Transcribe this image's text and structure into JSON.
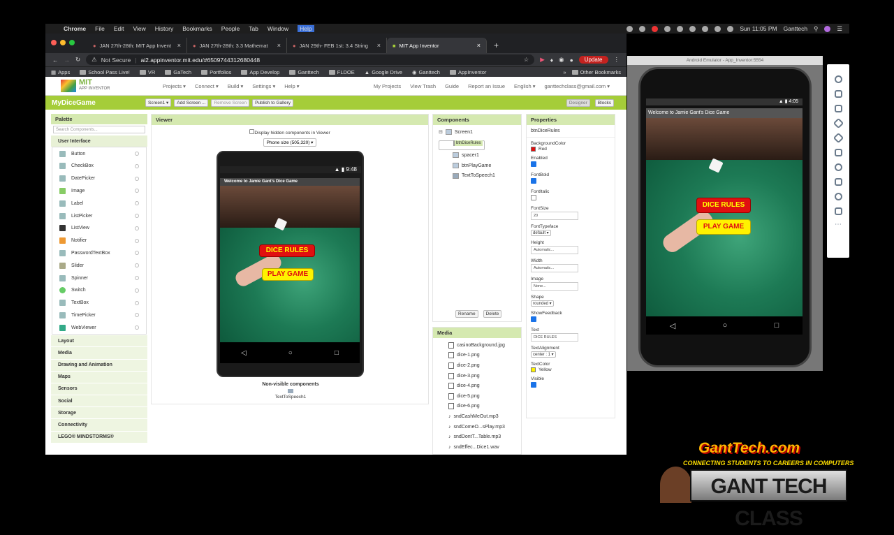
{
  "menubar": {
    "app": "Chrome",
    "items": [
      "File",
      "Edit",
      "View",
      "History",
      "Bookmarks",
      "People",
      "Tab",
      "Window",
      "Help"
    ],
    "clock": "Sun 11:05 PM",
    "user": "Ganttech"
  },
  "tabs": [
    {
      "label": "JAN 27th-28th: MIT App Invent"
    },
    {
      "label": "JAN 27th-28th: 3.3 Mathemat"
    },
    {
      "label": "JAN 29th- FEB 1st: 3.4 String"
    },
    {
      "label": "MIT App Inventor",
      "active": true
    }
  ],
  "address": {
    "security": "Not Secure",
    "url": "ai2.appinventor.mit.edu/#6509744312680448",
    "update": "Update"
  },
  "bookmarks": [
    "Apps",
    "School Pass Live!",
    "VR",
    "GaTech",
    "Portfolios",
    "App Develop",
    "Ganttech",
    "FLDOE",
    "Google Drive",
    "Ganttech",
    "AppInventor",
    "Other Bookmarks"
  ],
  "ai_header": {
    "logo_title": "MIT",
    "logo_sub": "APP INVENTOR",
    "nav": [
      "Projects ▾",
      "Connect ▾",
      "Build ▾",
      "Settings ▾",
      "Help ▾"
    ],
    "right": [
      "My Projects",
      "View Trash",
      "Guide",
      "Report an Issue",
      "English ▾",
      "ganttechclass@gmail.com ▾"
    ]
  },
  "project": {
    "name": "MyDiceGame",
    "screen": "Screen1 ▾",
    "add_screen": "Add Screen ...",
    "remove_screen": "Remove Screen",
    "publish": "Publish to Gallery",
    "designer": "Designer",
    "blocks": "Blocks"
  },
  "palette": {
    "title": "Palette",
    "search_placeholder": "Search Components...",
    "category": "User Interface",
    "items": [
      "Button",
      "CheckBox",
      "DatePicker",
      "Image",
      "Label",
      "ListPicker",
      "ListView",
      "Notifier",
      "PasswordTextBox",
      "Slider",
      "Spinner",
      "Switch",
      "TextBox",
      "TimePicker",
      "WebViewer"
    ],
    "categories": [
      "Layout",
      "Media",
      "Drawing and Animation",
      "Maps",
      "Sensors",
      "Social",
      "Storage",
      "Connectivity",
      "LEGO® MINDSTORMS®"
    ]
  },
  "viewer": {
    "title": "Viewer",
    "hidden_label": "Display hidden components in Viewer",
    "phone_size": "Phone size (505,320) ▾",
    "time": "9:48",
    "app_title": "Welcome to Jamie Gant's Dice Game",
    "btn1": "DICE RULES",
    "btn2": "PLAY GAME",
    "nonvisible_label": "Non-visible components",
    "nonvisible_item": "TextToSpeech1"
  },
  "components": {
    "title": "Components",
    "root": "Screen1",
    "children": [
      "btnDiceRules",
      "spacer1",
      "btnPlayGame",
      "TextToSpeech1"
    ],
    "rename": "Rename",
    "delete": "Delete"
  },
  "media": {
    "title": "Media",
    "files": [
      "casinoBackground.jpg",
      "dice-1.png",
      "dice-2.png",
      "dice-3.png",
      "dice-4.png",
      "dice-5.png",
      "dice-6.png",
      "sndCashMeOut.mp3",
      "sndComeO...sPlay.mp3",
      "sndDontT...Table.mp3",
      "sndEffec...Dice1.wav"
    ]
  },
  "properties": {
    "title": "Properties",
    "component": "btnDiceRules",
    "background_label": "BackgroundColor",
    "background_value": "Red",
    "enabled": "Enabled",
    "fontbold": "FontBold",
    "fontitalic": "FontItalic",
    "fontsize": "FontSize",
    "fontsize_value": "20",
    "typeface": "FontTypeface",
    "typeface_value": "default ▾",
    "height": "Height",
    "height_value": "Automatic...",
    "width": "Width",
    "width_value": "Automatic...",
    "image": "Image",
    "image_value": "None...",
    "shape": "Shape",
    "shape_value": "rounded ▾",
    "showfeedback": "ShowFeedback",
    "text": "Text",
    "text_value": "DICE RULES",
    "textalign": "TextAlignment",
    "textalign_value": "center : 1 ▾",
    "textcolor": "TextColor",
    "textcolor_value": "Yellow",
    "visible": "Visible"
  },
  "emulator": {
    "title": "Android Emulator - App_Inventor:5554",
    "time": "4:05",
    "app_title": "Welcome to Jamie Gant's Dice Game",
    "btn1": "DICE RULES",
    "btn2": "PLAY GAME"
  },
  "brand": {
    "site": "GantTech.com",
    "tagline": "CONNECTING STUDENTS TO CAREERS IN COMPUTERS",
    "logo_text": "GANT TECH CLASS"
  },
  "colors": {
    "accent": "#a5cd39",
    "red": "#e01010",
    "yellow": "#fff200"
  }
}
